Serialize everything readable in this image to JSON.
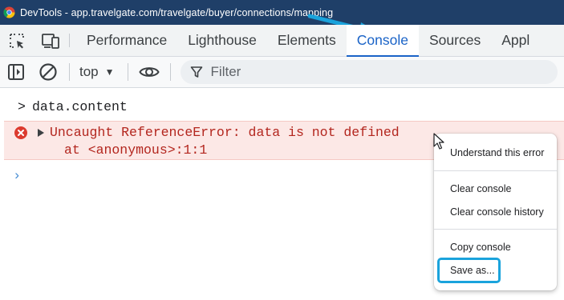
{
  "titlebar": {
    "title": "DevTools - app.travelgate.com/travelgate/buyer/connections/mapping"
  },
  "tabs": [
    {
      "label": "Performance",
      "active": false
    },
    {
      "label": "Lighthouse",
      "active": false
    },
    {
      "label": "Elements",
      "active": false
    },
    {
      "label": "Console",
      "active": true
    },
    {
      "label": "Sources",
      "active": false
    },
    {
      "label": "Appl",
      "active": false
    }
  ],
  "toolbar": {
    "context": "top",
    "filter_placeholder": "Filter"
  },
  "console": {
    "command": "data.content",
    "error_message": "Uncaught ReferenceError: data is not defined",
    "error_location": "at <anonymous>:1:1"
  },
  "context_menu": {
    "items": [
      "Understand this error",
      "Clear console",
      "Clear console history",
      "Copy console",
      "Save as..."
    ],
    "highlighted": "Save as..."
  },
  "colors": {
    "titlebar_bg": "#1f3f68",
    "active_tab": "#1a63c7",
    "error_text": "#b3261e",
    "error_bg": "#fce8e6",
    "annotation": "#1aa3dc"
  }
}
